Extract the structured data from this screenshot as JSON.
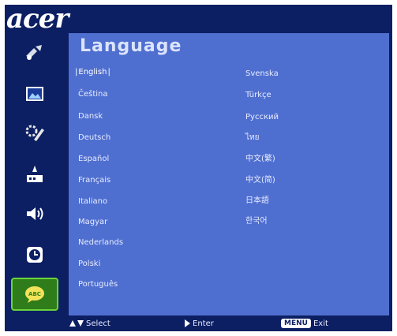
{
  "brand": "acer",
  "title": "Language",
  "sidebar": {
    "items": [
      {
        "icon": "image-adjust-icon",
        "active": false
      },
      {
        "icon": "picture-icon",
        "active": false
      },
      {
        "icon": "settings-icon",
        "active": false
      },
      {
        "icon": "management-icon",
        "active": false
      },
      {
        "icon": "audio-icon",
        "active": false
      },
      {
        "icon": "timer-icon",
        "active": false
      },
      {
        "icon": "language-icon",
        "active": true
      }
    ]
  },
  "languages": {
    "left": [
      "English",
      "Čeština",
      "Dansk",
      "Deutsch",
      "Español",
      "Français",
      "Italiano",
      "Magyar",
      "Nederlands",
      "Polski",
      "Português"
    ],
    "right": [
      "Svenska",
      "Türkçe",
      "Русский",
      "ไทย",
      "中文(繁)",
      "中文(简)",
      "日本語",
      "한국어"
    ],
    "selected": "English"
  },
  "footer": {
    "select_label": "Select",
    "enter_label": "Enter",
    "menu_key": "MENU",
    "exit_label": "Exit"
  },
  "colors": {
    "background": "#0c1f63",
    "panel": "#4f6fd0",
    "active_item": "#2f7d1a"
  }
}
